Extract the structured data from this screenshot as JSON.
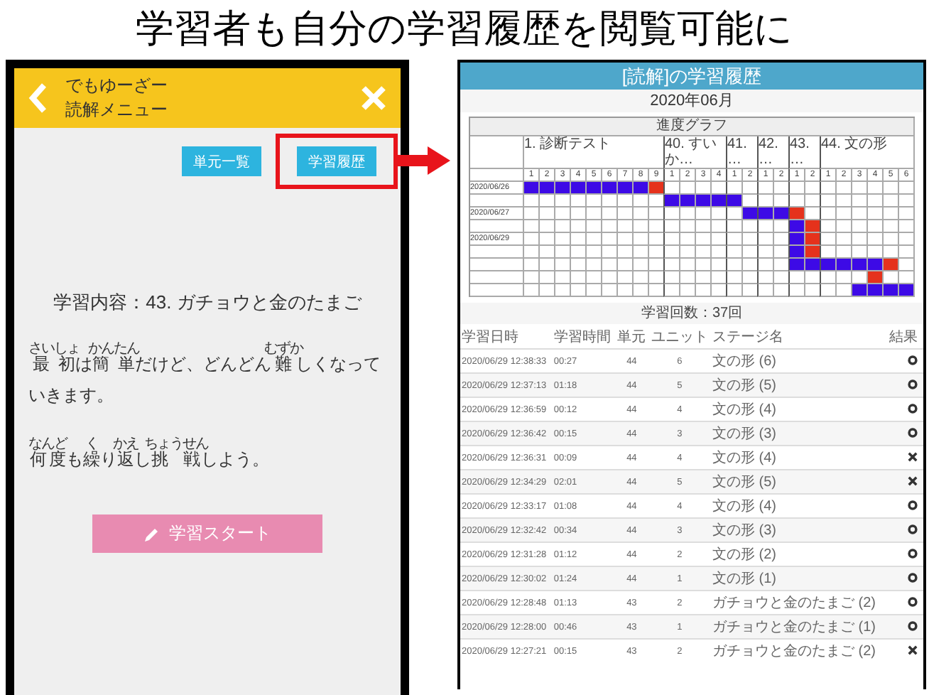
{
  "headline": "学習者も自分の学習履歴を閲覧可能に",
  "phone": {
    "header": {
      "user": "でもゆーざー",
      "menu": "読解メニュー"
    },
    "buttons": [
      {
        "label": "単元一覧",
        "highlighted": false
      },
      {
        "label": "学習履歴",
        "highlighted": true
      }
    ],
    "content": "学習内容：43. ガチョウと金のたまご",
    "paragraphs": [
      [
        {
          "kind": "ruby",
          "base": "最初",
          "reading": "さいしょ"
        },
        {
          "kind": "plain",
          "text": "は"
        },
        {
          "kind": "ruby",
          "base": "簡単",
          "reading": "かんたん"
        },
        {
          "kind": "plain",
          "text": "だけど、どんどん"
        },
        {
          "kind": "ruby",
          "base": "難",
          "reading": "むずか"
        },
        {
          "kind": "plain",
          "text": "しくなっていきます。"
        }
      ],
      [
        {
          "kind": "ruby",
          "base": "何度",
          "reading": "なんど"
        },
        {
          "kind": "plain",
          "text": "も"
        },
        {
          "kind": "ruby",
          "base": "繰",
          "reading": "く"
        },
        {
          "kind": "plain",
          "text": "り"
        },
        {
          "kind": "ruby",
          "base": "返",
          "reading": "かえ"
        },
        {
          "kind": "plain",
          "text": "し"
        },
        {
          "kind": "ruby",
          "base": "挑戦",
          "reading": "ちょうせん"
        },
        {
          "kind": "plain",
          "text": "しよう。"
        }
      ]
    ],
    "start_button": "学習スタート"
  },
  "history": {
    "title": "[読解]の学習履歴",
    "month": "2020年06月",
    "graph": {
      "title": "進度グラフ",
      "groups": [
        {
          "label": "1. 診断テスト",
          "stages": [
            "1",
            "2",
            "3",
            "4",
            "5",
            "6",
            "7",
            "8",
            "9"
          ]
        },
        {
          "label": "40. すいか…",
          "stages": [
            "1",
            "2",
            "3",
            "4"
          ]
        },
        {
          "label": "41. …",
          "stages": [
            "1",
            "2"
          ]
        },
        {
          "label": "42. …",
          "stages": [
            "1",
            "2"
          ]
        },
        {
          "label": "43. …",
          "stages": [
            "1",
            "2"
          ]
        },
        {
          "label": "44. 文の形",
          "stages": [
            "1",
            "2",
            "3",
            "4",
            "5",
            "6"
          ]
        }
      ],
      "rows": [
        {
          "date": "2020/06/26",
          "cells": [
            {
              "kind": "done"
            },
            {
              "kind": "done"
            },
            {
              "kind": "done"
            },
            {
              "kind": "done"
            },
            {
              "kind": "done"
            },
            {
              "kind": "done"
            },
            {
              "kind": "done"
            },
            {
              "kind": "done"
            },
            {
              "kind": "miss"
            },
            {
              "kind": "empty"
            },
            {
              "kind": "empty"
            },
            {
              "kind": "empty"
            },
            {
              "kind": "empty"
            },
            {
              "kind": "empty"
            },
            {
              "kind": "empty"
            },
            {
              "kind": "empty"
            },
            {
              "kind": "empty"
            },
            {
              "kind": "empty"
            },
            {
              "kind": "empty"
            },
            {
              "kind": "empty"
            },
            {
              "kind": "empty"
            },
            {
              "kind": "empty"
            },
            {
              "kind": "empty"
            },
            {
              "kind": "empty"
            },
            {
              "kind": "empty"
            }
          ]
        },
        {
          "cells": [
            {
              "kind": "empty"
            },
            {
              "kind": "empty"
            },
            {
              "kind": "empty"
            },
            {
              "kind": "empty"
            },
            {
              "kind": "empty"
            },
            {
              "kind": "empty"
            },
            {
              "kind": "empty"
            },
            {
              "kind": "empty"
            },
            {
              "kind": "empty"
            },
            {
              "kind": "done"
            },
            {
              "kind": "done"
            },
            {
              "kind": "done"
            },
            {
              "kind": "done"
            },
            {
              "kind": "done"
            },
            {
              "kind": "empty"
            },
            {
              "kind": "empty"
            },
            {
              "kind": "empty"
            },
            {
              "kind": "empty"
            },
            {
              "kind": "empty"
            },
            {
              "kind": "empty"
            },
            {
              "kind": "empty"
            },
            {
              "kind": "empty"
            },
            {
              "kind": "empty"
            },
            {
              "kind": "empty"
            },
            {
              "kind": "empty"
            }
          ]
        },
        {
          "date": "2020/06/27",
          "cells": [
            {
              "kind": "empty"
            },
            {
              "kind": "empty"
            },
            {
              "kind": "empty"
            },
            {
              "kind": "empty"
            },
            {
              "kind": "empty"
            },
            {
              "kind": "empty"
            },
            {
              "kind": "empty"
            },
            {
              "kind": "empty"
            },
            {
              "kind": "empty"
            },
            {
              "kind": "empty"
            },
            {
              "kind": "empty"
            },
            {
              "kind": "empty"
            },
            {
              "kind": "empty"
            },
            {
              "kind": "empty"
            },
            {
              "kind": "done"
            },
            {
              "kind": "done"
            },
            {
              "kind": "done"
            },
            {
              "kind": "miss"
            },
            {
              "kind": "empty"
            },
            {
              "kind": "empty"
            },
            {
              "kind": "empty"
            },
            {
              "kind": "empty"
            },
            {
              "kind": "empty"
            },
            {
              "kind": "empty"
            },
            {
              "kind": "empty"
            }
          ]
        },
        {
          "cells": [
            {
              "kind": "empty"
            },
            {
              "kind": "empty"
            },
            {
              "kind": "empty"
            },
            {
              "kind": "empty"
            },
            {
              "kind": "empty"
            },
            {
              "kind": "empty"
            },
            {
              "kind": "empty"
            },
            {
              "kind": "empty"
            },
            {
              "kind": "empty"
            },
            {
              "kind": "empty"
            },
            {
              "kind": "empty"
            },
            {
              "kind": "empty"
            },
            {
              "kind": "empty"
            },
            {
              "kind": "empty"
            },
            {
              "kind": "empty"
            },
            {
              "kind": "empty"
            },
            {
              "kind": "empty"
            },
            {
              "kind": "done"
            },
            {
              "kind": "miss"
            },
            {
              "kind": "empty"
            },
            {
              "kind": "empty"
            },
            {
              "kind": "empty"
            },
            {
              "kind": "empty"
            },
            {
              "kind": "empty"
            },
            {
              "kind": "empty"
            }
          ]
        },
        {
          "date": "2020/06/29",
          "cells": [
            {
              "kind": "empty"
            },
            {
              "kind": "empty"
            },
            {
              "kind": "empty"
            },
            {
              "kind": "empty"
            },
            {
              "kind": "empty"
            },
            {
              "kind": "empty"
            },
            {
              "kind": "empty"
            },
            {
              "kind": "empty"
            },
            {
              "kind": "empty"
            },
            {
              "kind": "empty"
            },
            {
              "kind": "empty"
            },
            {
              "kind": "empty"
            },
            {
              "kind": "empty"
            },
            {
              "kind": "empty"
            },
            {
              "kind": "empty"
            },
            {
              "kind": "empty"
            },
            {
              "kind": "empty"
            },
            {
              "kind": "done"
            },
            {
              "kind": "miss"
            },
            {
              "kind": "empty"
            },
            {
              "kind": "empty"
            },
            {
              "kind": "empty"
            },
            {
              "kind": "empty"
            },
            {
              "kind": "empty"
            },
            {
              "kind": "empty"
            }
          ]
        },
        {
          "cells": [
            {
              "kind": "empty"
            },
            {
              "kind": "empty"
            },
            {
              "kind": "empty"
            },
            {
              "kind": "empty"
            },
            {
              "kind": "empty"
            },
            {
              "kind": "empty"
            },
            {
              "kind": "empty"
            },
            {
              "kind": "empty"
            },
            {
              "kind": "empty"
            },
            {
              "kind": "empty"
            },
            {
              "kind": "empty"
            },
            {
              "kind": "empty"
            },
            {
              "kind": "empty"
            },
            {
              "kind": "empty"
            },
            {
              "kind": "empty"
            },
            {
              "kind": "empty"
            },
            {
              "kind": "empty"
            },
            {
              "kind": "done"
            },
            {
              "kind": "miss"
            },
            {
              "kind": "empty"
            },
            {
              "kind": "empty"
            },
            {
              "kind": "empty"
            },
            {
              "kind": "empty"
            },
            {
              "kind": "empty"
            },
            {
              "kind": "empty"
            }
          ]
        },
        {
          "cells": [
            {
              "kind": "empty"
            },
            {
              "kind": "empty"
            },
            {
              "kind": "empty"
            },
            {
              "kind": "empty"
            },
            {
              "kind": "empty"
            },
            {
              "kind": "empty"
            },
            {
              "kind": "empty"
            },
            {
              "kind": "empty"
            },
            {
              "kind": "empty"
            },
            {
              "kind": "empty"
            },
            {
              "kind": "empty"
            },
            {
              "kind": "empty"
            },
            {
              "kind": "empty"
            },
            {
              "kind": "empty"
            },
            {
              "kind": "empty"
            },
            {
              "kind": "empty"
            },
            {
              "kind": "empty"
            },
            {
              "kind": "done"
            },
            {
              "kind": "done"
            },
            {
              "kind": "done"
            },
            {
              "kind": "done"
            },
            {
              "kind": "done"
            },
            {
              "kind": "done"
            },
            {
              "kind": "miss"
            },
            {
              "kind": "empty"
            }
          ]
        },
        {
          "cells": [
            {
              "kind": "empty"
            },
            {
              "kind": "empty"
            },
            {
              "kind": "empty"
            },
            {
              "kind": "empty"
            },
            {
              "kind": "empty"
            },
            {
              "kind": "empty"
            },
            {
              "kind": "empty"
            },
            {
              "kind": "empty"
            },
            {
              "kind": "empty"
            },
            {
              "kind": "empty"
            },
            {
              "kind": "empty"
            },
            {
              "kind": "empty"
            },
            {
              "kind": "empty"
            },
            {
              "kind": "empty"
            },
            {
              "kind": "empty"
            },
            {
              "kind": "empty"
            },
            {
              "kind": "empty"
            },
            {
              "kind": "empty"
            },
            {
              "kind": "empty"
            },
            {
              "kind": "empty"
            },
            {
              "kind": "empty"
            },
            {
              "kind": "empty"
            },
            {
              "kind": "miss"
            },
            {
              "kind": "empty"
            },
            {
              "kind": "empty"
            }
          ]
        },
        {
          "cells": [
            {
              "kind": "empty"
            },
            {
              "kind": "empty"
            },
            {
              "kind": "empty"
            },
            {
              "kind": "empty"
            },
            {
              "kind": "empty"
            },
            {
              "kind": "empty"
            },
            {
              "kind": "empty"
            },
            {
              "kind": "empty"
            },
            {
              "kind": "empty"
            },
            {
              "kind": "empty"
            },
            {
              "kind": "empty"
            },
            {
              "kind": "empty"
            },
            {
              "kind": "empty"
            },
            {
              "kind": "empty"
            },
            {
              "kind": "empty"
            },
            {
              "kind": "empty"
            },
            {
              "kind": "empty"
            },
            {
              "kind": "empty"
            },
            {
              "kind": "empty"
            },
            {
              "kind": "empty"
            },
            {
              "kind": "empty"
            },
            {
              "kind": "done"
            },
            {
              "kind": "done"
            },
            {
              "kind": "done"
            },
            {
              "kind": "done"
            }
          ]
        }
      ]
    },
    "count": "学習回数：37回",
    "table": {
      "columns": [
        "学習日時",
        "学習時間",
        "単元",
        "ユニット",
        "ステージ名",
        "結果"
      ],
      "rows": [
        {
          "datetime": "2020/06/29 12:38:33",
          "duration": "00:27",
          "unit": "44",
          "stage_no": "6",
          "stage": "文の形 (6)",
          "kind": "pass"
        },
        {
          "datetime": "2020/06/29 12:37:13",
          "duration": "01:18",
          "unit": "44",
          "stage_no": "5",
          "stage": "文の形 (5)",
          "kind": "pass"
        },
        {
          "datetime": "2020/06/29 12:36:59",
          "duration": "00:12",
          "unit": "44",
          "stage_no": "4",
          "stage": "文の形 (4)",
          "kind": "pass"
        },
        {
          "datetime": "2020/06/29 12:36:42",
          "duration": "00:15",
          "unit": "44",
          "stage_no": "3",
          "stage": "文の形 (3)",
          "kind": "pass"
        },
        {
          "datetime": "2020/06/29 12:36:31",
          "duration": "00:09",
          "unit": "44",
          "stage_no": "4",
          "stage": "文の形 (4)",
          "kind": "fail"
        },
        {
          "datetime": "2020/06/29 12:34:29",
          "duration": "02:01",
          "unit": "44",
          "stage_no": "5",
          "stage": "文の形 (5)",
          "kind": "fail"
        },
        {
          "datetime": "2020/06/29 12:33:17",
          "duration": "01:08",
          "unit": "44",
          "stage_no": "4",
          "stage": "文の形 (4)",
          "kind": "pass"
        },
        {
          "datetime": "2020/06/29 12:32:42",
          "duration": "00:34",
          "unit": "44",
          "stage_no": "3",
          "stage": "文の形 (3)",
          "kind": "pass"
        },
        {
          "datetime": "2020/06/29 12:31:28",
          "duration": "01:12",
          "unit": "44",
          "stage_no": "2",
          "stage": "文の形 (2)",
          "kind": "pass"
        },
        {
          "datetime": "2020/06/29 12:30:02",
          "duration": "01:24",
          "unit": "44",
          "stage_no": "1",
          "stage": "文の形 (1)",
          "kind": "pass"
        },
        {
          "datetime": "2020/06/29 12:28:48",
          "duration": "01:13",
          "unit": "43",
          "stage_no": "2",
          "stage": "ガチョウと金のたまご (2)",
          "kind": "pass"
        },
        {
          "datetime": "2020/06/29 12:28:00",
          "duration": "00:46",
          "unit": "43",
          "stage_no": "1",
          "stage": "ガチョウと金のたまご (1)",
          "kind": "pass"
        },
        {
          "datetime": "2020/06/29 12:27:21",
          "duration": "00:15",
          "unit": "43",
          "stage_no": "2",
          "stage": "ガチョウと金のたまご (2)",
          "kind": "fail"
        }
      ]
    }
  }
}
